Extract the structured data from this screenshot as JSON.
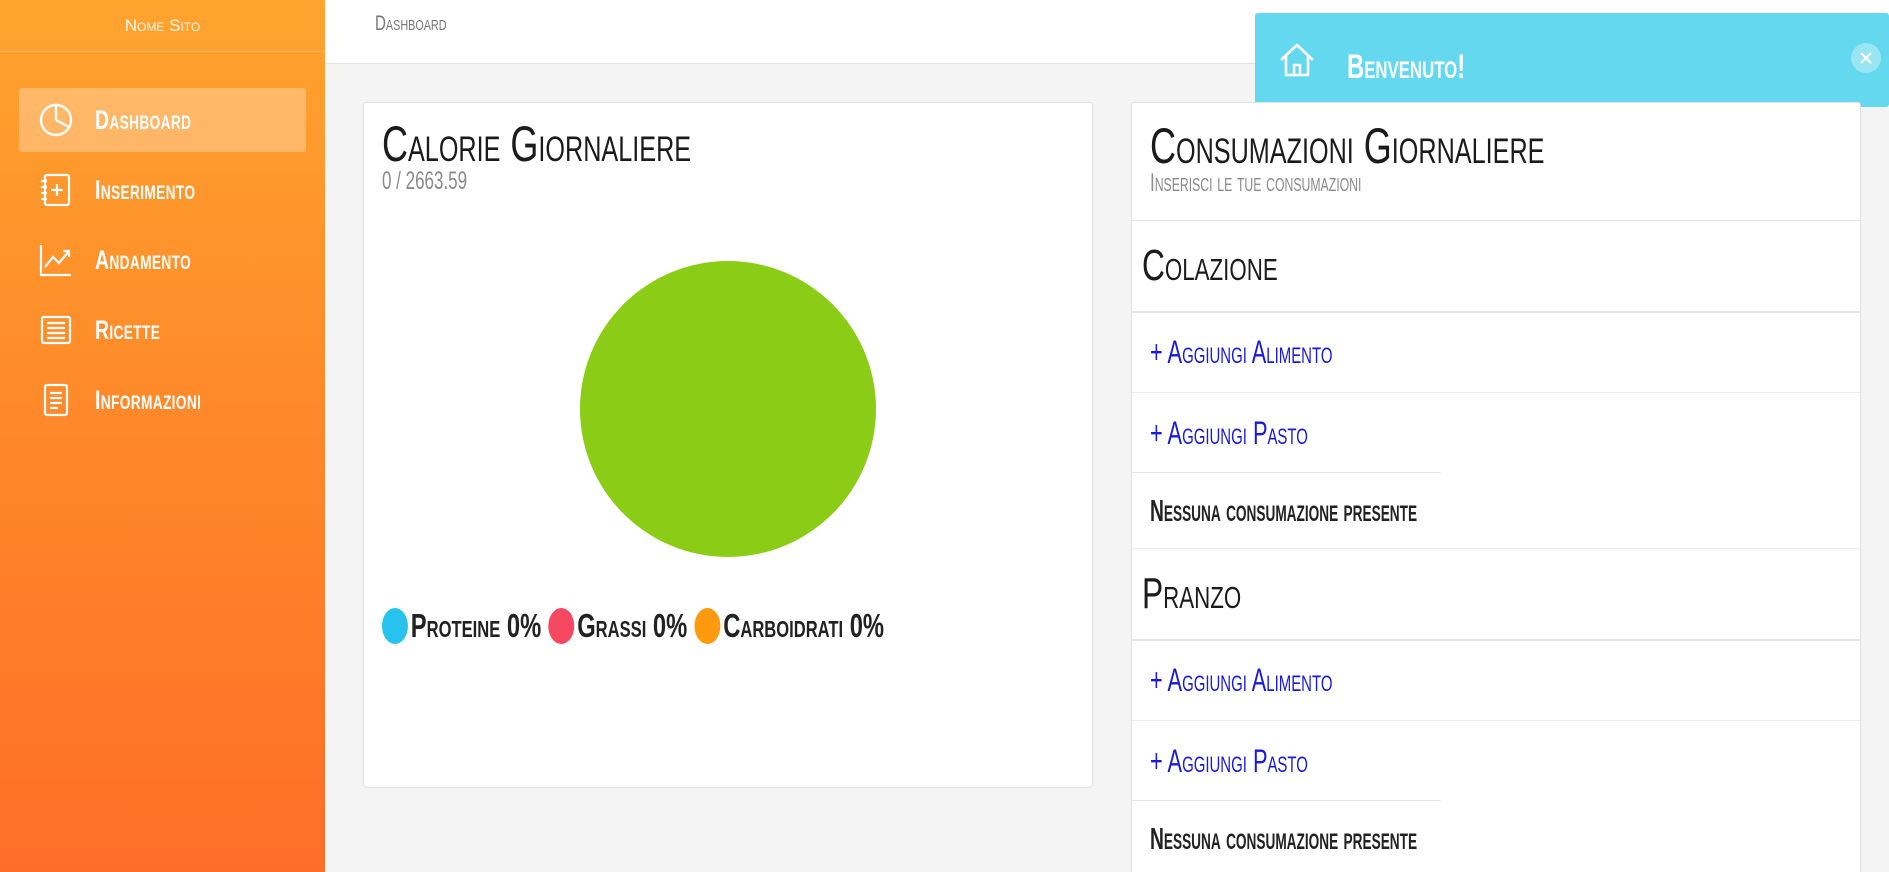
{
  "app": {
    "brand": "Nome Sito"
  },
  "sidebar": {
    "items": [
      {
        "label": "Dashboard",
        "icon": "pie-chart-icon"
      },
      {
        "label": "Inserimento",
        "icon": "notebook-add-icon"
      },
      {
        "label": "Andamento",
        "icon": "trend-chart-icon"
      },
      {
        "label": "Ricette",
        "icon": "recipe-book-icon"
      },
      {
        "label": "Informazioni",
        "icon": "document-icon"
      }
    ],
    "active_index": 0
  },
  "topbar": {
    "breadcrumb": "Dashboard"
  },
  "toast": {
    "message": "Benvenuto!",
    "icon": "home-icon",
    "color": "#63d8ef"
  },
  "calorie_card": {
    "title": "Calorie Giornaliere",
    "subtitle": "0 / 2663.59"
  },
  "chart_data": {
    "type": "pie",
    "slices": [
      {
        "name": "Proteine",
        "value": 0,
        "color": "#28c2ee"
      },
      {
        "name": "Grassi",
        "value": 0,
        "color": "#f5475f"
      },
      {
        "name": "Carboidrati",
        "value": 0,
        "color": "#ff9a0e"
      },
      {
        "name": "",
        "value": 100,
        "color": "#8bcc17"
      }
    ],
    "legend": [
      {
        "label": "Proteine 0%",
        "color": "#28c2ee"
      },
      {
        "label": "Grassi 0%",
        "color": "#f5475f"
      },
      {
        "label": "Carboidrati 0%",
        "color": "#ff9a0e"
      }
    ]
  },
  "consumi_card": {
    "title": "Consumazioni Giornaliere",
    "subtitle": "Inserisci le tue consumazioni",
    "sections": [
      {
        "title": "Colazione",
        "add_food": "+ Aggiungi Alimento",
        "add_meal": "+ Aggiungi Pasto",
        "empty": "Nessuna consumazione presente"
      },
      {
        "title": "Pranzo",
        "add_food": "+ Aggiungi Alimento",
        "add_meal": "+ Aggiungi Pasto",
        "empty": "Nessuna consumazione presente"
      }
    ]
  }
}
